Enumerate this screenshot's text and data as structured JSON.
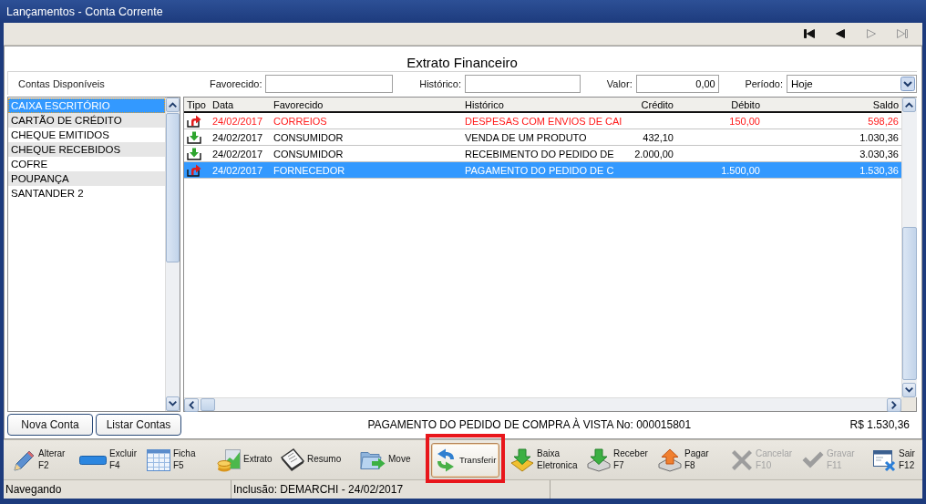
{
  "window": {
    "title": "Lançamentos - Conta Corrente"
  },
  "navigator": [
    {
      "kind": "first",
      "disabled": false
    },
    {
      "kind": "prev",
      "disabled": false
    },
    {
      "kind": "next",
      "disabled": true
    },
    {
      "kind": "last",
      "disabled": true
    }
  ],
  "panel_title": "Extrato Financeiro",
  "filters": {
    "accounts_label": "Contas Disponíveis",
    "fields": [
      {
        "label": "Favorecido:"
      },
      {
        "label": "Histórico:"
      },
      {
        "label": "Valor:",
        "value": "0,00"
      }
    ],
    "period": {
      "label": "Período:",
      "value": "Hoje"
    }
  },
  "accounts": [
    {
      "name": "CAIXA ESCRITÓRIO",
      "selected": true
    },
    {
      "name": "CARTÃO DE CRÉDITO",
      "selected": false
    },
    {
      "name": "CHEQUE EMITIDOS",
      "selected": false
    },
    {
      "name": "CHEQUE RECEBIDOS",
      "selected": false
    },
    {
      "name": "COFRE",
      "selected": false
    },
    {
      "name": "POUPANÇA",
      "selected": false
    },
    {
      "name": "SANTANDER 2",
      "selected": false
    }
  ],
  "table": {
    "columns": [
      "Tipo",
      "Data",
      "Favorecido",
      "Histórico",
      "Crédito",
      "Débito",
      "Saldo"
    ],
    "rows": [
      {
        "kind": "out",
        "flagged": true,
        "selected": false,
        "date": "24/02/2017",
        "payee": "CORREIOS",
        "history": "DESPESAS COM ENVIOS DE CAI",
        "debit": "150,00",
        "balance": "598,26"
      },
      {
        "kind": "in",
        "flagged": false,
        "selected": false,
        "date": "24/02/2017",
        "payee": "CONSUMIDOR",
        "history": "VENDA DE UM PRODUTO",
        "credit": "432,10",
        "balance": "1.030,36"
      },
      {
        "kind": "in",
        "flagged": false,
        "selected": false,
        "date": "24/02/2017",
        "payee": "CONSUMIDOR",
        "history": "RECEBIMENTO DO PEDIDO DE",
        "credit": "2.000,00",
        "balance": "3.030,36"
      },
      {
        "kind": "out",
        "flagged": false,
        "selected": true,
        "date": "24/02/2017",
        "payee": "FORNECEDOR",
        "history": "PAGAMENTO DO PEDIDO DE C",
        "debit": "1.500,00",
        "balance": "1.530,36"
      }
    ]
  },
  "account_buttons": [
    "Nova Conta",
    "Listar Contas"
  ],
  "detail": {
    "description": "PAGAMENTO DO PEDIDO DE COMPRA À VISTA No: 000015801",
    "total": "R$ 1.530,36"
  },
  "toolbar": [
    {
      "kind": "edit",
      "lines": [
        "Alterar",
        "F2"
      ],
      "disabled": false,
      "focused": false,
      "annotated": false
    },
    {
      "kind": "delete",
      "lines": [
        "Excluir",
        "F4"
      ],
      "disabled": false,
      "focused": false,
      "annotated": false
    },
    {
      "kind": "card",
      "lines": [
        "Ficha",
        "F5"
      ],
      "disabled": false,
      "focused": false,
      "annotated": false
    },
    {
      "kind": "statement",
      "lines": [
        "Extrato"
      ],
      "disabled": false,
      "focused": false,
      "annotated": false
    },
    {
      "kind": "summary",
      "lines": [
        "Resumo"
      ],
      "disabled": false,
      "focused": false,
      "annotated": false
    },
    {
      "kind": "move",
      "lines": [
        "Move"
      ],
      "disabled": false,
      "focused": false,
      "annotated": false
    },
    {
      "kind": "transfer",
      "lines": [
        "Transferir"
      ],
      "disabled": false,
      "focused": true,
      "annotated": true
    },
    {
      "kind": "ebank",
      "lines": [
        "Baixa",
        "Eletronica"
      ],
      "disabled": false,
      "focused": false,
      "annotated": false
    },
    {
      "kind": "receive",
      "lines": [
        "Receber",
        "F7"
      ],
      "disabled": false,
      "focused": false,
      "annotated": false
    },
    {
      "kind": "pay",
      "lines": [
        "Pagar",
        "F8"
      ],
      "disabled": false,
      "focused": false,
      "annotated": false
    },
    {
      "kind": "cancel",
      "lines": [
        "Cancelar",
        "F10"
      ],
      "disabled": true,
      "focused": false,
      "annotated": false
    },
    {
      "kind": "save",
      "lines": [
        "Gravar",
        "F11"
      ],
      "disabled": true,
      "focused": false,
      "annotated": false
    },
    {
      "kind": "exit",
      "lines": [
        "Sair",
        "F12"
      ],
      "disabled": false,
      "focused": false,
      "annotated": false
    }
  ],
  "status_bar": [
    "Navegando",
    "Inclusão: DEMARCHI - 24/02/2017"
  ]
}
